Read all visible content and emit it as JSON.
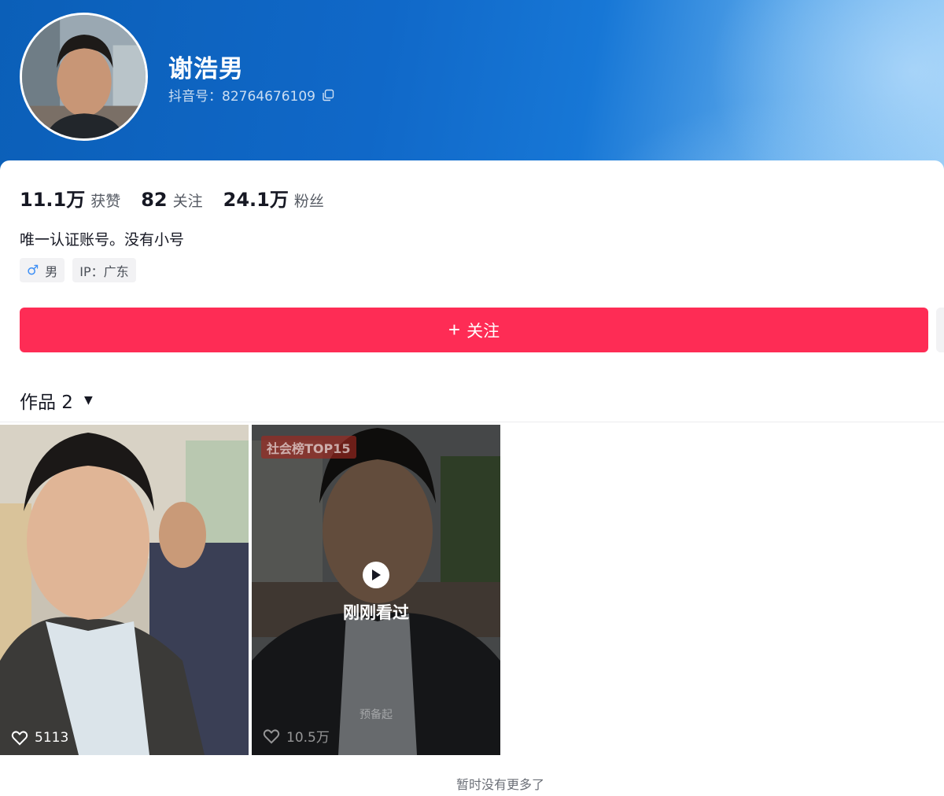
{
  "profile": {
    "nickname": "谢浩男",
    "douyin_id": "抖音号：82764676109",
    "bio": "唯一认证账号。没有小号",
    "gender_tag": "男",
    "ip_tag": "IP：广东"
  },
  "stats": [
    {
      "value": "11.1万",
      "label": "获赞"
    },
    {
      "value": "82",
      "label": "关注"
    },
    {
      "value": "24.1万",
      "label": "粉丝"
    }
  ],
  "actions": {
    "follow_label": "关注"
  },
  "works": {
    "tab_label": "作品 2",
    "items": [
      {
        "likes": "5113"
      },
      {
        "likes": "10.5万",
        "badge": "社会榜TOP15",
        "overlay_label": "刚刚看过",
        "subtitle": "预备起"
      }
    ],
    "end_note": "暂时没有更多了"
  },
  "colors": {
    "header_blue": "#1068c8",
    "follow_red": "#fe2c55"
  }
}
